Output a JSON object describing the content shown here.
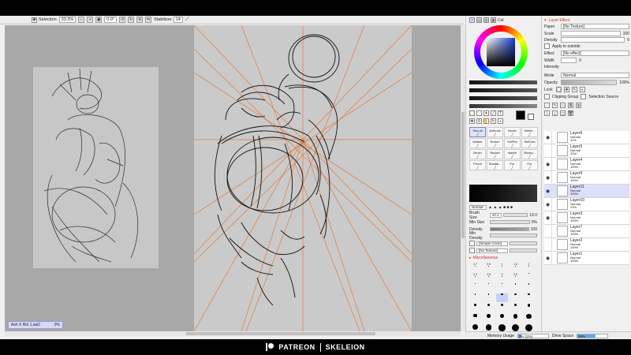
{
  "toolbar": {
    "selection_label": "Selection",
    "zoom": "33.3%",
    "angle": "0.0°",
    "stabilizer_label": "Stabilizer",
    "stabilizer_value": "14"
  },
  "canvas": {
    "document_tab": "Ash X Rin 1.sai2",
    "document_tab_value": "0%"
  },
  "color_panel": {
    "tabs": [
      "Col"
    ],
    "current_color": "#000000"
  },
  "tools": [
    {
      "label": "Sha all",
      "selected": true
    },
    {
      "label": "Airbrush"
    },
    {
      "label": "Brush"
    },
    {
      "label": "Water..."
    },
    {
      "label": "Marker"
    },
    {
      "label": "Eraser"
    },
    {
      "label": "SelPen"
    },
    {
      "label": "SelEras"
    },
    {
      "label": "Brush"
    },
    {
      "label": "Bucket"
    },
    {
      "label": "sketch"
    },
    {
      "label": "Binary..."
    },
    {
      "label": "Pencil"
    },
    {
      "label": "Shadai..."
    },
    {
      "label": "Fur"
    },
    {
      "label": "Fur"
    }
  ],
  "brush_settings": {
    "mode": "Normal",
    "brush_size_label": "Brush Size",
    "brush_size_mult": "x0.1",
    "brush_size_value": "19.0",
    "min_size_label": "Min Size",
    "min_size_value": "0%",
    "density_label": "Density",
    "density_value": "100",
    "min_density_label": "Min Density",
    "shape_label": "[Simple Circle]",
    "texture_label": "[No Texture]",
    "misc_label": "Miscellaneous"
  },
  "brush_sizes": [
    "0.7",
    "0.8",
    "1",
    "1.5",
    "2",
    "2.3",
    "2.6",
    "3",
    "3.5",
    "4",
    "5",
    "6",
    "7",
    "8",
    "9",
    "10",
    "12",
    "14",
    "16",
    "20",
    "25",
    "30",
    "35",
    "40",
    "50",
    "60",
    "70",
    "80",
    "100",
    "120",
    "160",
    "200",
    "250",
    "300",
    "350"
  ],
  "selected_brush_size": "14",
  "layer_effect": {
    "header": "Layer Effect",
    "paper_label": "Paper",
    "paper_value": "[No Texture]",
    "scale_label": "Scale",
    "scale_value": "100",
    "density_label": "Density",
    "density_value": "0",
    "apply_label": "Apply to outside",
    "effect_label": "Effect",
    "effect_value": "[No effect]",
    "width_label": "Width",
    "width_value": "0",
    "intensity_label": "Intensity"
  },
  "layer_props": {
    "mode_label": "Mode",
    "mode_value": "Normal",
    "opacity_label": "Opacity",
    "opacity_value": "100%",
    "lock_label": "Lock",
    "clipping_label": "Clipping Group",
    "selection_source_label": "Selection Source"
  },
  "layers": [
    {
      "name": "Layer6",
      "mode": "Normal",
      "opacity": "11%",
      "visible": true
    },
    {
      "name": "Layer5",
      "mode": "Normal",
      "opacity": "23%",
      "visible": false
    },
    {
      "name": "Layer4",
      "mode": "Normal",
      "opacity": "100%",
      "visible": true
    },
    {
      "name": "Layer9",
      "mode": "Normal",
      "opacity": "100%",
      "visible": true
    },
    {
      "name": "Layer11",
      "mode": "Normal",
      "opacity": "100%",
      "visible": true,
      "selected": true
    },
    {
      "name": "Layer10",
      "mode": "Normal",
      "opacity": "23%",
      "visible": true
    },
    {
      "name": "Layer3",
      "mode": "Normal",
      "opacity": "100%",
      "visible": true
    },
    {
      "name": "Layer7",
      "mode": "Normal",
      "opacity": "100%",
      "visible": false
    },
    {
      "name": "Layer2",
      "mode": "Normal",
      "opacity": "100%",
      "visible": false
    },
    {
      "name": "Layer1",
      "mode": "Normal",
      "opacity": "100%",
      "visible": true
    }
  ],
  "status": {
    "memory_label": "Memory Usage",
    "memory_value": "3% (3%)",
    "drive_label": "Drive Space",
    "drive_value": "59%"
  },
  "footer": {
    "left": "PATREON",
    "right": "SKELEION"
  },
  "colors": {
    "guide_line": "#e07b3f",
    "canvas_bg": "#a8a8a8",
    "paper": "#c7c7c7",
    "selection_blue": "#dde0fb"
  }
}
